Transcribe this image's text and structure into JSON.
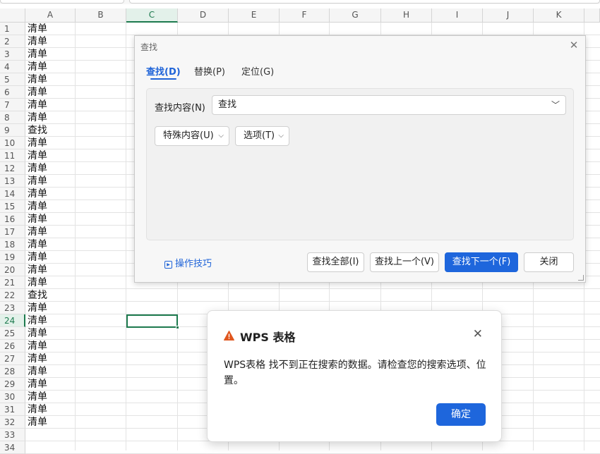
{
  "sheet": {
    "columns": [
      "A",
      "B",
      "C",
      "D",
      "E",
      "F",
      "G",
      "H",
      "I",
      "J",
      "K"
    ],
    "selected_column": "C",
    "selected_row": 24,
    "rows": [
      "1",
      "2",
      "3",
      "4",
      "5",
      "6",
      "7",
      "8",
      "9",
      "10",
      "11",
      "12",
      "13",
      "14",
      "15",
      "16",
      "17",
      "18",
      "19",
      "20",
      "21",
      "22",
      "23",
      "24",
      "25",
      "26",
      "27",
      "28",
      "29",
      "30",
      "31",
      "32",
      "33",
      "34"
    ],
    "column_a": [
      "清单",
      "清单",
      "清单",
      "清单",
      "清单",
      "清单",
      "清单",
      "清单",
      "查找",
      "清单",
      "清单",
      "清单",
      "清单",
      "清单",
      "清单",
      "清单",
      "清单",
      "清单",
      "清单",
      "清单",
      "清单",
      "查找",
      "清单",
      "清单",
      "清单",
      "清单",
      "清单",
      "清单",
      "清单",
      "清单",
      "清单",
      "清单"
    ],
    "accent_color": "#1d7a4e"
  },
  "find_dialog": {
    "title": "查找",
    "tabs": [
      {
        "label": "查找(D)",
        "active": true
      },
      {
        "label": "替换(P)",
        "active": false
      },
      {
        "label": "定位(G)",
        "active": false
      }
    ],
    "find_label": "查找内容(N)",
    "find_value": "查找",
    "special_label": "特殊内容(U)",
    "options_label": "选项(T)",
    "tips_label": "操作技巧",
    "buttons": {
      "find_all": "查找全部(I)",
      "find_prev": "查找上一个(V)",
      "find_next": "查找下一个(F)",
      "close": "关闭"
    },
    "accent_color": "#1e66dc"
  },
  "message_box": {
    "title": "WPS 表格",
    "message": "WPS表格 找不到正在搜索的数据。请检查您的搜索选项、位置。",
    "ok_label": "确定",
    "warning_color": "#e0561e"
  }
}
